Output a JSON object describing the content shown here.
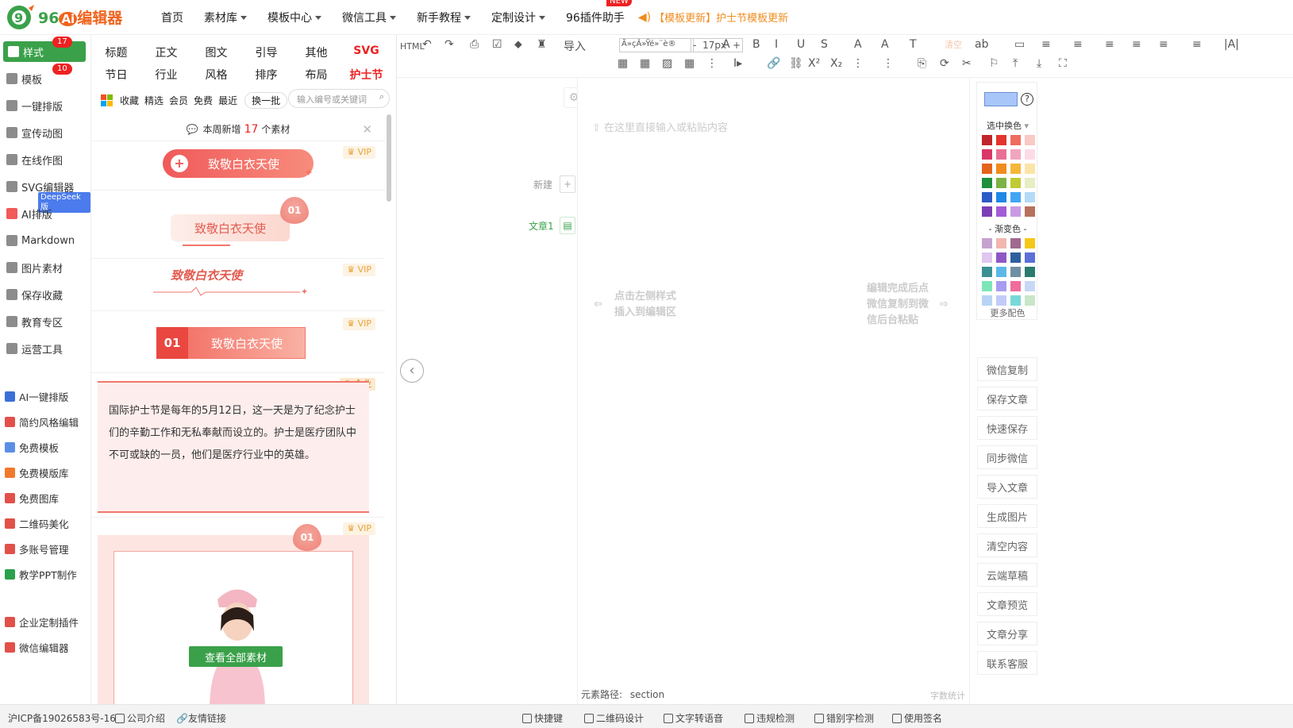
{
  "header": {
    "logo_text": "96",
    "logo_ai": "Ai",
    "logo_suffix": "编辑器",
    "nav": [
      {
        "label": "首页",
        "dropdown": false
      },
      {
        "label": "素材库",
        "dropdown": true
      },
      {
        "label": "模板中心",
        "dropdown": true
      },
      {
        "label": "微信工具",
        "dropdown": true
      },
      {
        "label": "新手教程",
        "dropdown": true
      },
      {
        "label": "定制设计",
        "dropdown": true
      },
      {
        "label": "96插件助手",
        "dropdown": false
      }
    ],
    "new_badge": "NEW",
    "announcement": "【模板更新】护士节模板更新"
  },
  "sidebar": {
    "top_items": [
      {
        "label": "样式",
        "badge": "17",
        "active": true
      },
      {
        "label": "模板",
        "badge": "10"
      },
      {
        "label": "一键排版"
      },
      {
        "label": "宣传动图"
      },
      {
        "label": "在线作图"
      },
      {
        "label": "SVG编辑器",
        "tag": "DeepSeek版"
      },
      {
        "label": "AI排版"
      },
      {
        "label": "Markdown"
      },
      {
        "label": "图片素材"
      },
      {
        "label": "保存收藏"
      },
      {
        "label": "教育专区"
      },
      {
        "label": "运营工具"
      }
    ],
    "bottom_items": [
      {
        "label": "AI一键排版",
        "color": "#3b6fd8"
      },
      {
        "label": "简约风格编辑",
        "color": "#e2504a"
      },
      {
        "label": "免费模板",
        "color": "#5b8ee6"
      },
      {
        "label": "免费模版库",
        "color": "#f07a2a"
      },
      {
        "label": "免费图库",
        "color": "#e2504a"
      },
      {
        "label": "二维码美化",
        "color": "#e2504a"
      },
      {
        "label": "多账号管理",
        "color": "#e2504a"
      },
      {
        "label": "教学PPT制作",
        "color": "#2aa14a"
      },
      {
        "label": "企业定制插件",
        "color": "#e2504a"
      },
      {
        "label": "微信编辑器",
        "color": "#e2504a"
      }
    ]
  },
  "panel": {
    "categories_row1": [
      "标题",
      "正文",
      "图文",
      "引导",
      "其他",
      "SVG"
    ],
    "categories_row2": [
      "节日",
      "行业",
      "风格",
      "排序",
      "布局",
      "护士节"
    ],
    "filters": [
      "收藏",
      "精选",
      "会员",
      "免费",
      "最近"
    ],
    "swap_label": "换一批",
    "search_placeholder": "输入编号或关键词",
    "weekly_prefix": "本周新增",
    "weekly_count": "17",
    "weekly_suffix": "个素材",
    "template_title": "致敬白衣天使",
    "number_tag": "01",
    "vip_label": "VIP",
    "enterprise_label": "企业",
    "body_text": "国际护士节是每年的5月12日，这一天是为了纪念护士们的辛勤工作和无私奉献而设立的。护士是医疗团队中不可或缺的一员，他们是医疗行业中的英雄。",
    "see_all_label": "查看全部素材"
  },
  "toolbar": {
    "row1": [
      "HTML",
      "↶",
      "↷",
      "⎙",
      "☑",
      "⬥",
      "♜",
      "导入",
      "A",
      "B",
      "I",
      "U",
      "S",
      "A",
      "A",
      "T",
      "清空",
      "ab",
      "▭",
      "≡",
      "≡",
      "≡",
      "≡",
      "≡",
      "≡",
      "|A|"
    ],
    "font_value": "Ã»çÂ»Ÿé»¨è®",
    "size_value": "17px",
    "row2": [
      "▦",
      "▦",
      "▨",
      "▦",
      "⋮",
      "I▸",
      "🔗",
      "⛓",
      "X²",
      "X₂",
      "⋮",
      "⋮",
      "⎘",
      "⟳",
      "✂",
      "⚐",
      "⤒",
      "⤓",
      "⛶"
    ]
  },
  "editor": {
    "new_label": "新建",
    "doc_label": "文章1",
    "placeholder": "在这里直接输入或粘贴内容",
    "hint_left_line1": "点击左侧样式",
    "hint_left_line2": "插入到编辑区",
    "hint_right_line1": "编辑完成后点",
    "hint_right_line2": "微信复制到微",
    "hint_right_line3": "信后台粘贴",
    "path_label": "元素路径:",
    "path_value": "section",
    "word_count_label": "字数统计"
  },
  "color_panel": {
    "selected_color": "#a8c6f8",
    "help": "?",
    "title": "选中换色",
    "gradient_title": "- 渐变色 -",
    "more_label": "更多配色",
    "solid_swatches": [
      [
        "#c0262b",
        "#e2342d",
        "#ef6b60",
        "#f9c9c4"
      ],
      [
        "#d93767",
        "#ea6f95",
        "#f2a5bf",
        "#fbdbe6"
      ],
      [
        "#e4651a",
        "#f08c1e",
        "#f5b73a",
        "#fbe4a8"
      ],
      [
        "#1e8f3a",
        "#7cb342",
        "#c0ca33",
        "#e6eec3"
      ],
      [
        "#2b5bc6",
        "#1e88e5",
        "#42a5f5",
        "#b3daf7"
      ],
      [
        "#7b3fb5",
        "#a25cd6",
        "#c89be4",
        "#b7705e"
      ]
    ],
    "gradient_swatches": [
      [
        "#c6a3cf",
        "#f1b7b0",
        "#a06a8e",
        "#f5c71a"
      ],
      [
        "#e0c6f0",
        "#8e58c4",
        "#2d5fa0",
        "#5b6fd8"
      ],
      [
        "#3a8f93",
        "#5ab8e8",
        "#6f8fa3",
        "#2b7a6e"
      ],
      [
        "#7ce6b8",
        "#a79cf0",
        "#f06c9b",
        "#c7d8f5"
      ],
      [
        "#b7d4f5",
        "#c2ccf8",
        "#7ad8d8",
        "#c8e6c9"
      ]
    ]
  },
  "actions": [
    "微信复制",
    "保存文章",
    "快速保存",
    "同步微信",
    "导入文章",
    "生成图片",
    "清空内容",
    "云端草稿",
    "文章预览",
    "文章分享",
    "联系客服"
  ],
  "footer": {
    "icp": "沪ICP备19026583号-16",
    "company": "公司介绍",
    "links": "友情链接",
    "tools": [
      "快捷键",
      "二维码设计",
      "文字转语音",
      "违规检测",
      "错别字检测",
      "使用签名"
    ]
  }
}
